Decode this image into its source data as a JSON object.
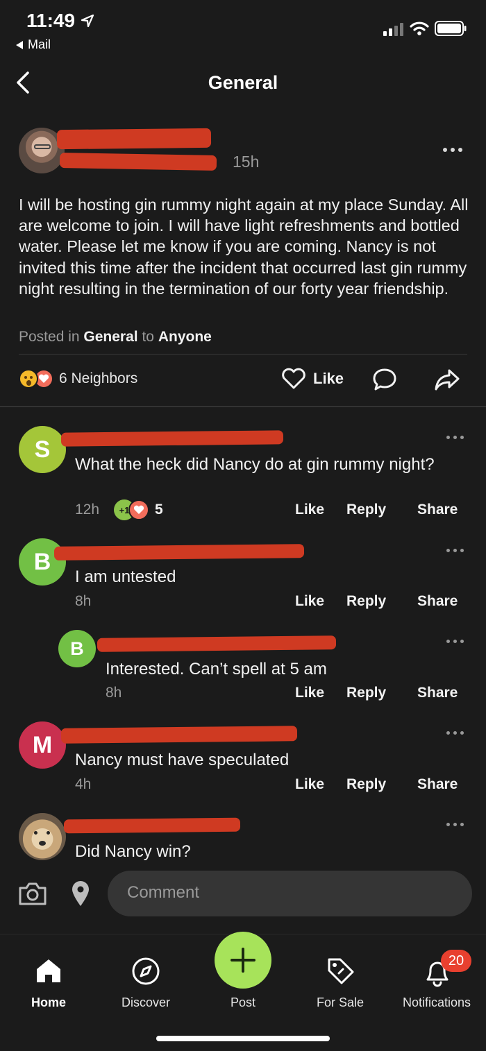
{
  "status_bar": {
    "time": "11:49",
    "back_app": "Mail"
  },
  "header": {
    "title": "General"
  },
  "post": {
    "time": "15h",
    "body": "I will be hosting gin rummy night again at my place Sunday. All are welcome to join. I will have light refreshments and bottled water. Please let me know if you are coming. Nancy is not invited this time after the incident that occurred last gin rummy night resulting in the termination of our forty year friendship.",
    "posted_in_prefix": "Posted in",
    "posted_in_channel": "General",
    "posted_to_prefix": "to",
    "posted_to_audience": "Anyone",
    "reactions_label": "6 Neighbors",
    "like_label": "Like"
  },
  "comments": [
    {
      "initial": "S",
      "text": "What the heck did Nancy do at gin rummy night?",
      "time": "12h",
      "reaction_badge": "+1",
      "reaction_count": "5",
      "like": "Like",
      "reply": "Reply",
      "share": "Share",
      "avatar_color": "#a4c639"
    },
    {
      "initial": "B",
      "text": "I am untested",
      "time": "8h",
      "like": "Like",
      "reply": "Reply",
      "share": "Share",
      "avatar_color": "#72c045"
    },
    {
      "initial": "B",
      "text": "Interested. Can’t spell at 5 am",
      "time": "8h",
      "like": "Like",
      "reply": "Reply",
      "share": "Share",
      "avatar_color": "#72c045"
    },
    {
      "initial": "M",
      "text": "Nancy must have speculated",
      "time": "4h",
      "like": "Like",
      "reply": "Reply",
      "share": "Share",
      "avatar_color": "#c9304f"
    },
    {
      "text": "Did Nancy win?"
    }
  ],
  "composer": {
    "placeholder": "Comment"
  },
  "bottom_nav": {
    "home": "Home",
    "discover": "Discover",
    "post": "Post",
    "for_sale": "For Sale",
    "notifications": "Notifications",
    "notifications_badge": "20"
  },
  "colors": {
    "accent_green": "#a7e35a",
    "notification_red": "#e8402f",
    "redaction": "#cf3a22"
  }
}
